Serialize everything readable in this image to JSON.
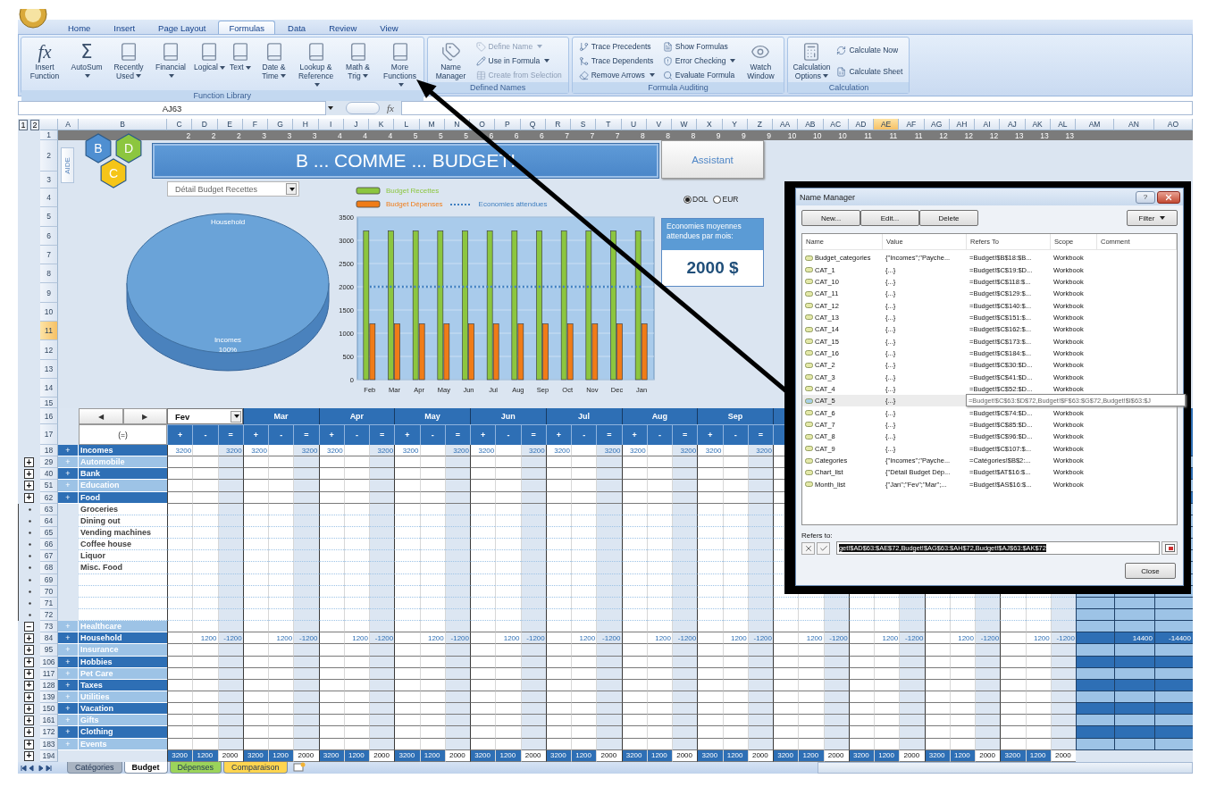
{
  "ribbon": {
    "tabs": [
      {
        "label": "Home",
        "selected": false
      },
      {
        "label": "Insert",
        "selected": false
      },
      {
        "label": "Page Layout",
        "selected": false
      },
      {
        "label": "Formulas",
        "selected": true
      },
      {
        "label": "Data",
        "selected": false
      },
      {
        "label": "Review",
        "selected": false
      },
      {
        "label": "View",
        "selected": false
      }
    ],
    "groups": [
      {
        "label": "Function Library",
        "items": [
          {
            "kind": "large",
            "label": "Insert Function",
            "glyph": "fx",
            "dropdown": false
          },
          {
            "kind": "large",
            "label": "AutoSum",
            "glyph": "Σ",
            "dropdown": true
          },
          {
            "kind": "large",
            "label": "Recently Used",
            "dropdown": true
          },
          {
            "kind": "large",
            "label": "Financial",
            "dropdown": true
          },
          {
            "kind": "large",
            "label": "Logical",
            "dropdown": true
          },
          {
            "kind": "large",
            "label": "Text",
            "dropdown": true
          },
          {
            "kind": "large",
            "label": "Date & Time",
            "dropdown": true
          },
          {
            "kind": "large",
            "label": "Lookup & Reference",
            "dropdown": true
          },
          {
            "kind": "large",
            "label": "Math & Trig",
            "dropdown": true
          },
          {
            "kind": "large",
            "label": "More Functions",
            "dropdown": true
          }
        ]
      },
      {
        "label": "Defined Names",
        "items": [
          {
            "kind": "large",
            "label": "Name Manager",
            "dropdown": false
          },
          {
            "kind": "stack",
            "buttons": [
              {
                "label": "Define Name",
                "dropdown": true,
                "disabled": true
              },
              {
                "label": "Use in Formula",
                "dropdown": true,
                "disabled": false
              },
              {
                "label": "Create from Selection",
                "dropdown": false,
                "disabled": true
              }
            ]
          }
        ]
      },
      {
        "label": "Formula Auditing",
        "items": [
          {
            "kind": "stack",
            "buttons": [
              {
                "label": "Trace Precedents",
                "dropdown": false,
                "disabled": false
              },
              {
                "label": "Trace Dependents",
                "dropdown": false,
                "disabled": false
              },
              {
                "label": "Remove Arrows",
                "dropdown": true,
                "disabled": false
              }
            ]
          },
          {
            "kind": "stack",
            "buttons": [
              {
                "label": "Show Formulas",
                "dropdown": false,
                "disabled": false
              },
              {
                "label": "Error Checking",
                "dropdown": true,
                "disabled": false
              },
              {
                "label": "Evaluate Formula",
                "dropdown": false,
                "disabled": false
              }
            ]
          },
          {
            "kind": "large",
            "label": "Watch Window",
            "dropdown": false
          }
        ]
      },
      {
        "label": "Calculation",
        "items": [
          {
            "kind": "large",
            "label": "Calculation Options",
            "dropdown": true
          },
          {
            "kind": "stack",
            "buttons": [
              {
                "label": "Calculate Now",
                "dropdown": false,
                "disabled": false
              },
              {
                "label": "Calculate Sheet",
                "dropdown": false,
                "disabled": false
              }
            ]
          }
        ]
      }
    ]
  },
  "formula_bar": {
    "name_box": "AJ63",
    "fx": "fx"
  },
  "sheet": {
    "outline_levels": [
      "1",
      "2"
    ],
    "columns": [
      {
        "label": "A",
        "selected": false
      },
      {
        "label": "B",
        "selected": false
      },
      {
        "label": "C",
        "selected": false
      },
      {
        "label": "D",
        "selected": false
      },
      {
        "label": "E",
        "selected": false
      },
      {
        "label": "F",
        "selected": false
      },
      {
        "label": "G",
        "selected": false
      },
      {
        "label": "H",
        "selected": false
      },
      {
        "label": "I",
        "selected": false
      },
      {
        "label": "J",
        "selected": false
      },
      {
        "label": "K",
        "selected": false
      },
      {
        "label": "L",
        "selected": false
      },
      {
        "label": "M",
        "selected": false
      },
      {
        "label": "N",
        "selected": false
      },
      {
        "label": "O",
        "selected": false
      },
      {
        "label": "P",
        "selected": false
      },
      {
        "label": "Q",
        "selected": false
      },
      {
        "label": "R",
        "selected": false
      },
      {
        "label": "S",
        "selected": false
      },
      {
        "label": "T",
        "selected": false
      },
      {
        "label": "U",
        "selected": false
      },
      {
        "label": "V",
        "selected": false
      },
      {
        "label": "W",
        "selected": false
      },
      {
        "label": "X",
        "selected": false
      },
      {
        "label": "Y",
        "selected": false
      },
      {
        "label": "Z",
        "selected": false
      },
      {
        "label": "AA",
        "selected": false
      },
      {
        "label": "AB",
        "selected": false
      },
      {
        "label": "AC",
        "selected": false
      },
      {
        "label": "AD",
        "selected": false
      },
      {
        "label": "AE",
        "selected": true
      },
      {
        "label": "AF",
        "selected": false
      },
      {
        "label": "AG",
        "selected": false
      },
      {
        "label": "AH",
        "selected": false
      },
      {
        "label": "AI",
        "selected": false
      },
      {
        "label": "AJ",
        "selected": false
      },
      {
        "label": "AK",
        "selected": false
      },
      {
        "label": "AL",
        "selected": false
      },
      {
        "label": "AM",
        "selected": false
      },
      {
        "label": "AN",
        "selected": false
      },
      {
        "label": "AO",
        "selected": false
      }
    ],
    "row_1": [
      "2",
      "2",
      "2",
      "3",
      "3",
      "3",
      "4",
      "4",
      "4",
      "5",
      "5",
      "5",
      "6",
      "6",
      "6",
      "7",
      "7",
      "7",
      "8",
      "8",
      "8",
      "9",
      "9",
      "9",
      "10",
      "10",
      "10",
      "11",
      "11",
      "11",
      "12",
      "12",
      "12",
      "13",
      "13",
      "13"
    ],
    "row_headers": [
      {
        "label": "1",
        "selected": false
      },
      {
        "label": "2",
        "selected": false
      },
      {
        "label": "3",
        "selected": false
      },
      {
        "label": "4",
        "selected": false
      },
      {
        "label": "5",
        "selected": false
      },
      {
        "label": "6",
        "selected": false
      },
      {
        "label": "7",
        "selected": false
      },
      {
        "label": "8",
        "selected": false
      },
      {
        "label": "9",
        "selected": false
      },
      {
        "label": "10",
        "selected": false
      },
      {
        "label": "11",
        "selected": true
      },
      {
        "label": "12",
        "selected": false
      },
      {
        "label": "13",
        "selected": false
      },
      {
        "label": "14",
        "selected": false
      },
      {
        "label": "15",
        "selected": false
      }
    ],
    "dashboard": {
      "aide": "AIDE",
      "logo": [
        "B",
        "D",
        "C"
      ],
      "title": "B ... COMME ... BUDGET!",
      "assistant": "Assistant",
      "chart_selector": "Détail Budget Recettes",
      "currency": [
        {
          "label": "DOL",
          "selected": true
        },
        {
          "label": "EUR",
          "selected": false
        }
      ],
      "savings": {
        "label": "Economies moyennes attendues par mois:",
        "value": "2000 $"
      },
      "pie": {
        "chart_data": {
          "type": "pie",
          "categories": [
            "Household",
            "Incomes"
          ],
          "values": [
            0,
            100
          ],
          "value_labels": [
            null,
            "100%"
          ]
        }
      },
      "bars": {
        "chart_data": {
          "type": "bar",
          "categories": [
            "Feb",
            "Mar",
            "Apr",
            "May",
            "Jun",
            "Jul",
            "Aug",
            "Sep",
            "Oct",
            "Nov",
            "Dec",
            "Jan"
          ],
          "series": [
            {
              "name": "Budget Recettes",
              "type": "bar",
              "color": "#8cc63f",
              "values": [
                3200,
                3200,
                3200,
                3200,
                3200,
                3200,
                3200,
                3200,
                3200,
                3200,
                3200,
                3200
              ]
            },
            {
              "name": "Budget Dépenses",
              "type": "bar",
              "color": "#f07c18",
              "values": [
                1200,
                1200,
                1200,
                1200,
                1200,
                1200,
                1200,
                1200,
                1200,
                1200,
                1200,
                1200
              ]
            },
            {
              "name": "Economies attendues",
              "type": "line",
              "line_style": "dotted",
              "color": "#3f7fc0",
              "values": [
                2000,
                2000,
                2000,
                2000,
                2000,
                2000,
                2000,
                2000,
                2000,
                2000,
                2000,
                2000
              ]
            }
          ],
          "ylim": [
            0,
            3500
          ],
          "yticks": [
            0,
            500,
            1000,
            1500,
            2000,
            2500,
            3000,
            3500
          ],
          "grid": true,
          "legend": true
        }
      }
    },
    "grid": {
      "header_rows": [
        "16",
        "17"
      ],
      "nav": [
        "◀",
        "▶"
      ],
      "equal_label": "(=)",
      "months": [
        {
          "label": "Fev",
          "kind": "dropdown",
          "signs": [
            "+",
            "-",
            "="
          ]
        },
        {
          "label": "Mar",
          "kind": "header",
          "signs": [
            "+",
            "-",
            "="
          ]
        },
        {
          "label": "Apr",
          "kind": "header",
          "signs": [
            "+",
            "-",
            "="
          ]
        },
        {
          "label": "May",
          "kind": "header",
          "signs": [
            "+",
            "-",
            "="
          ]
        },
        {
          "label": "Jun",
          "kind": "header",
          "signs": [
            "+",
            "-",
            "="
          ]
        },
        {
          "label": "Jul",
          "kind": "header",
          "signs": [
            "+",
            "-",
            "="
          ]
        },
        {
          "label": "Aug",
          "kind": "header",
          "signs": [
            "+",
            "-",
            "="
          ]
        },
        {
          "label": "Sep",
          "kind": "header",
          "signs": [
            "+",
            "-",
            "="
          ]
        }
      ],
      "rows": [
        {
          "num": "18",
          "kind": "category",
          "label": "Incomes",
          "toggle": "+",
          "values": [
            {
              "plus": "3200",
              "equal": "3200"
            },
            {
              "plus": "3200",
              "equal": "3200"
            },
            {
              "plus": "3200",
              "equal": "3200"
            },
            {
              "plus": "3200",
              "equal": "3200"
            },
            {
              "plus": "3200",
              "equal": "3200"
            },
            {
              "plus": "3200",
              "equal": "3200"
            },
            {
              "plus": "3200",
              "equal": "3200"
            },
            {
              "plus": "3200",
              "equal": "3200"
            }
          ]
        },
        {
          "num": "29",
          "kind": "category",
          "label": "Automobile",
          "toggle": "+",
          "outline": "+"
        },
        {
          "num": "40",
          "kind": "category",
          "label": "Bank",
          "toggle": "+",
          "outline": "+"
        },
        {
          "num": "51",
          "kind": "category",
          "label": "Education",
          "toggle": "+",
          "outline": "+"
        },
        {
          "num": "62",
          "kind": "category",
          "label": "Food",
          "toggle": "+",
          "outline": "+"
        },
        {
          "num": "63",
          "kind": "item",
          "label": "Groceries"
        },
        {
          "num": "64",
          "kind": "item",
          "label": "Dining out"
        },
        {
          "num": "65",
          "kind": "item",
          "label": "Vending machines"
        },
        {
          "num": "66",
          "kind": "item",
          "label": "Coffee house"
        },
        {
          "num": "67",
          "kind": "item",
          "label": "Liquor"
        },
        {
          "num": "68",
          "kind": "item",
          "label": "Misc. Food"
        },
        {
          "num": "69",
          "kind": "item"
        },
        {
          "num": "70",
          "kind": "item"
        },
        {
          "num": "71",
          "kind": "item"
        },
        {
          "num": "72",
          "kind": "item"
        },
        {
          "num": "73",
          "kind": "category",
          "label": "Healthcare",
          "toggle": "+",
          "outline": "−"
        },
        {
          "num": "84",
          "kind": "category",
          "label": "Household",
          "toggle": "+",
          "outline": "+",
          "values": [
            {
              "minus": "1200",
              "equal": "-1200"
            },
            {
              "minus": "1200",
              "equal": "-1200"
            },
            {
              "minus": "1200",
              "equal": "-1200"
            },
            {
              "minus": "1200",
              "equal": "-1200"
            },
            {
              "minus": "1200",
              "equal": "-1200"
            },
            {
              "minus": "1200",
              "equal": "-1200"
            },
            {
              "minus": "1200",
              "equal": "-1200"
            },
            {
              "minus": "1200",
              "equal": "-1200"
            },
            {
              "minus": "1200",
              "equal": "-1200"
            },
            {
              "minus": "1200",
              "equal": "-1200"
            },
            {
              "minus": "1200",
              "equal": "-1200"
            },
            {
              "minus": "1200",
              "equal": "-1200"
            }
          ],
          "totals": {
            "AN": "14400",
            "AO": "-14400"
          }
        },
        {
          "num": "95",
          "kind": "category",
          "label": "Insurance",
          "toggle": "+",
          "outline": "+"
        },
        {
          "num": "106",
          "kind": "category",
          "label": "Hobbies",
          "toggle": "+",
          "outline": "+"
        },
        {
          "num": "117",
          "kind": "category",
          "label": "Pet Care",
          "toggle": "+",
          "outline": "+"
        },
        {
          "num": "128",
          "kind": "category",
          "label": "Taxes",
          "toggle": "+",
          "outline": "+"
        },
        {
          "num": "139",
          "kind": "category",
          "label": "Utilities",
          "toggle": "+",
          "outline": "+"
        },
        {
          "num": "150",
          "kind": "category",
          "label": "Vacation",
          "toggle": "+",
          "outline": "+"
        },
        {
          "num": "161",
          "kind": "category",
          "label": "Gifts",
          "toggle": "+",
          "outline": "+"
        },
        {
          "num": "172",
          "kind": "category",
          "label": "Clothing",
          "toggle": "+",
          "outline": "+"
        },
        {
          "num": "183",
          "kind": "category",
          "label": "Events",
          "toggle": "+",
          "outline": "+"
        },
        {
          "num": "194",
          "kind": "total",
          "outline": "+",
          "values": [
            {
              "plus": "3200",
              "minus": "1200",
              "equal": "2000"
            },
            {
              "plus": "3200",
              "minus": "1200",
              "equal": "2000"
            },
            {
              "plus": "3200",
              "minus": "1200",
              "equal": "2000"
            },
            {
              "plus": "3200",
              "minus": "1200",
              "equal": "2000"
            },
            {
              "plus": "3200",
              "minus": "1200",
              "equal": "2000"
            },
            {
              "plus": "3200",
              "minus": "1200",
              "equal": "2000"
            },
            {
              "plus": "3200",
              "minus": "1200",
              "equal": "2000"
            },
            {
              "plus": "3200",
              "minus": "1200",
              "equal": "2000"
            },
            {
              "plus": "3200",
              "minus": "1200",
              "equal": "2000"
            },
            {
              "plus": "3200",
              "minus": "1200",
              "equal": "2000"
            },
            {
              "plus": "3200",
              "minus": "1200",
              "equal": "2000"
            },
            {
              "plus": "3200",
              "minus": "1200",
              "equal": "2000"
            }
          ]
        }
      ]
    },
    "sheet_tabs": [
      {
        "label": "Catégories",
        "selected": false,
        "color": "#a9b4c2"
      },
      {
        "label": "Budget",
        "selected": true,
        "color": "#ffffff"
      },
      {
        "label": "Dépenses",
        "selected": false,
        "color": "#9bd35a"
      },
      {
        "label": "Comparaison",
        "selected": false,
        "color": "#ffd54f"
      }
    ]
  },
  "name_manager": {
    "title": "Name Manager",
    "help": "?",
    "buttons": [
      "New...",
      "Edit...",
      "Delete"
    ],
    "filter": "Filter",
    "columns": [
      "Name",
      "Value",
      "Refers To",
      "Scope",
      "Comment"
    ],
    "rows": [
      {
        "name": "Budget_categories",
        "value": "{\"Incomes\";\"Payche...",
        "refers_to": "=Budget!$B$18:$B...",
        "scope": "Workbook",
        "selected": false
      },
      {
        "name": "CAT_1",
        "value": "{...}",
        "refers_to": "=Budget!$C$19:$D...",
        "scope": "Workbook",
        "selected": false
      },
      {
        "name": "CAT_10",
        "value": "{...}",
        "refers_to": "=Budget!$C$118:$...",
        "scope": "Workbook",
        "selected": false
      },
      {
        "name": "CAT_11",
        "value": "{...}",
        "refers_to": "=Budget!$C$129:$...",
        "scope": "Workbook",
        "selected": false
      },
      {
        "name": "CAT_12",
        "value": "{...}",
        "refers_to": "=Budget!$C$140:$...",
        "scope": "Workbook",
        "selected": false
      },
      {
        "name": "CAT_13",
        "value": "{...}",
        "refers_to": "=Budget!$C$151:$...",
        "scope": "Workbook",
        "selected": false
      },
      {
        "name": "CAT_14",
        "value": "{...}",
        "refers_to": "=Budget!$C$162:$...",
        "scope": "Workbook",
        "selected": false
      },
      {
        "name": "CAT_15",
        "value": "{...}",
        "refers_to": "=Budget!$C$173:$...",
        "scope": "Workbook",
        "selected": false
      },
      {
        "name": "CAT_16",
        "value": "{...}",
        "refers_to": "=Budget!$C$184:$...",
        "scope": "Workbook",
        "selected": false
      },
      {
        "name": "CAT_2",
        "value": "{...}",
        "refers_to": "=Budget!$C$30:$D...",
        "scope": "Workbook",
        "selected": false
      },
      {
        "name": "CAT_3",
        "value": "{...}",
        "refers_to": "=Budget!$C$41:$D...",
        "scope": "Workbook",
        "selected": false
      },
      {
        "name": "CAT_4",
        "value": "{...}",
        "refers_to": "=Budget!$C$52:$D...",
        "scope": "Workbook",
        "selected": false
      },
      {
        "name": "CAT_5",
        "value": "{...}",
        "selected": true,
        "tooltip": "=Budget!$C$63:$D$72,Budget!$F$63:$G$72,Budget!$I$63:$J"
      },
      {
        "name": "CAT_6",
        "value": "{...}",
        "refers_to": "=Budget!$C$74:$D...",
        "scope": "Workbook",
        "selected": false
      },
      {
        "name": "CAT_7",
        "value": "{...}",
        "refers_to": "=Budget!$C$85:$D...",
        "scope": "Workbook",
        "selected": false
      },
      {
        "name": "CAT_8",
        "value": "{...}",
        "refers_to": "=Budget!$C$96:$D...",
        "scope": "Workbook",
        "selected": false
      },
      {
        "name": "CAT_9",
        "value": "{...}",
        "refers_to": "=Budget!$C$107:$...",
        "scope": "Workbook",
        "selected": false
      },
      {
        "name": "Categories",
        "value": "{\"Incomes\";\"Payche...",
        "refers_to": "=Catégories!$B$2:...",
        "scope": "Workbook",
        "selected": false
      },
      {
        "name": "Chart_list",
        "value": "{\"Détail Budget Dép...",
        "refers_to": "=Budget!$AT$16:$...",
        "scope": "Workbook",
        "selected": false
      },
      {
        "name": "Month_list",
        "value": "{\"Jan\";\"Fev\";\"Mar\";...",
        "refers_to": "=Budget!$AS$16:$...",
        "scope": "Workbook",
        "selected": false
      }
    ],
    "refers_label": "Refers to:",
    "refers_value": "get!$AD$63:$AE$72,Budget!$AG$63:$AH$72,Budget!$AJ$63:$AK$72",
    "close": "Close"
  }
}
